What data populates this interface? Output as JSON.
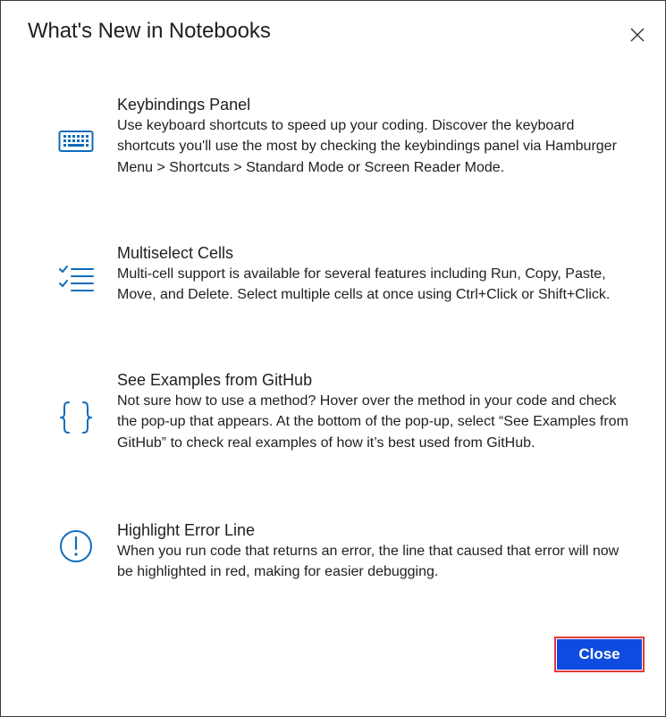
{
  "dialog": {
    "title": "What's New in Notebooks",
    "close_icon": "close-icon"
  },
  "features": [
    {
      "icon": "keyboard-icon",
      "heading": "Keybindings Panel",
      "description": "Use keyboard shortcuts to speed up your coding. Discover the keyboard shortcuts you'll use the most by checking the keybindings panel via Hamburger Menu > Shortcuts > Standard Mode or Screen Reader Mode."
    },
    {
      "icon": "checklist-icon",
      "heading": "Multiselect Cells",
      "description": "Multi-cell support is available for several features including Run, Copy, Paste, Move, and Delete. Select multiple cells at once using Ctrl+Click or Shift+Click."
    },
    {
      "icon": "curly-braces-icon",
      "heading": "See Examples from GitHub",
      "description": "Not sure how to use a method? Hover over the method in your code and check the pop-up that appears. At the bottom of the pop-up, select “See Examples from GitHub” to check real examples of how it’s best used from GitHub."
    },
    {
      "icon": "info-icon",
      "heading": "Highlight Error Line",
      "description": "When you run code that returns an error, the line that caused that error will now be highlighted in red, making for easier debugging."
    }
  ],
  "footer": {
    "close_label": "Close"
  },
  "colors": {
    "accent": "#0f6cbd",
    "button_bg": "#0f4be0",
    "button_focus_border": "#e03a3a"
  }
}
